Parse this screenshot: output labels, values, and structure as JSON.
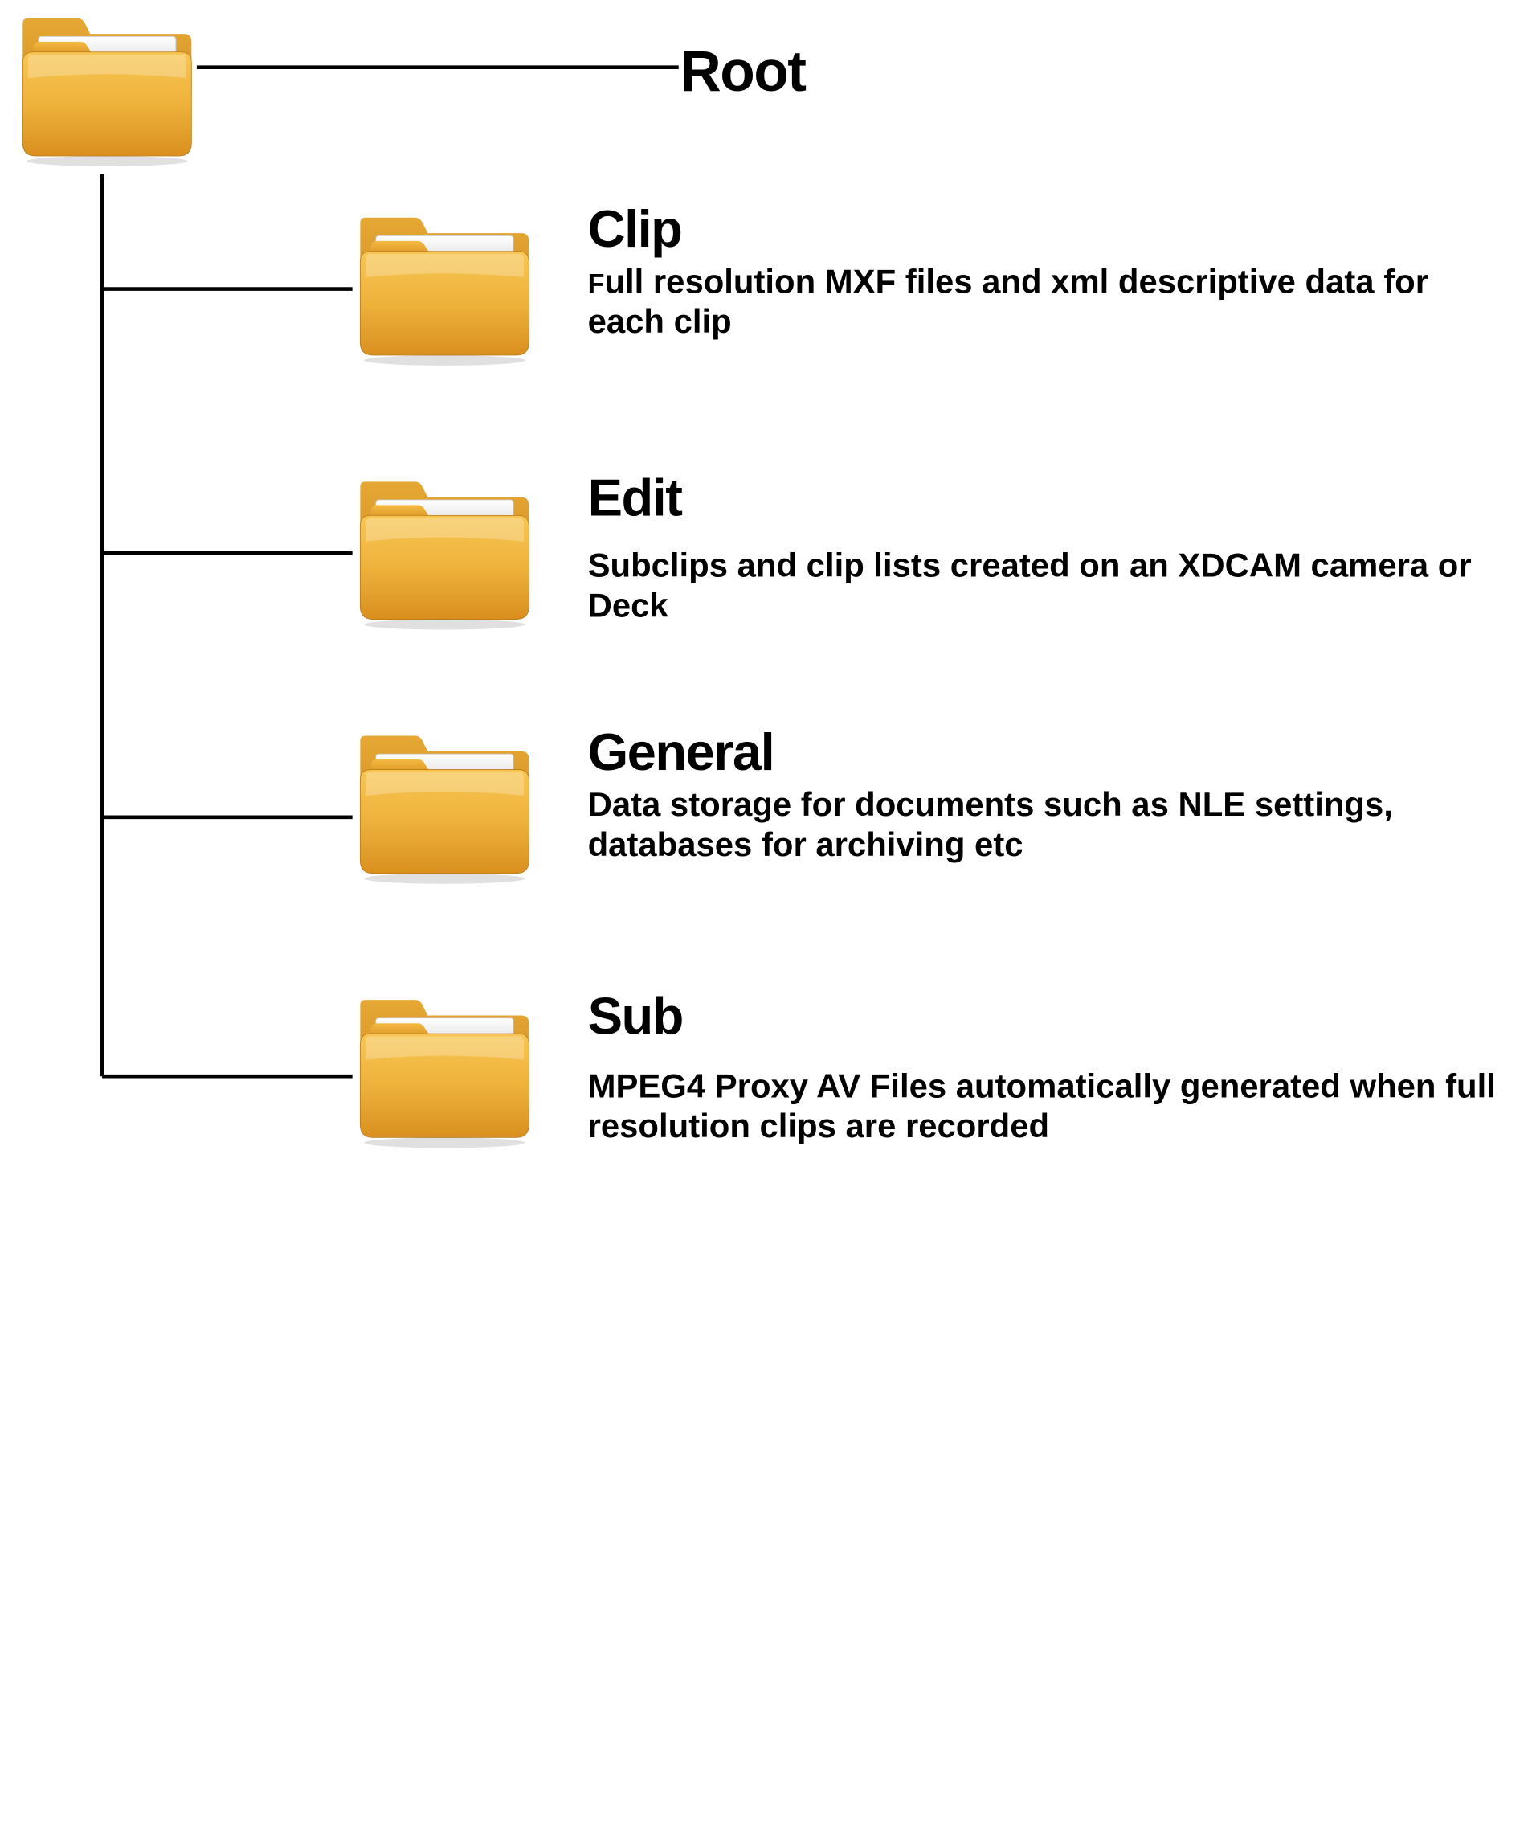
{
  "root": {
    "label": "Root"
  },
  "children": [
    {
      "title": "Clip",
      "desc_firstchar": "F",
      "desc_rest": "ull resolution MXF files and xml descriptive data for each clip"
    },
    {
      "title": "Edit",
      "desc_firstchar": "",
      "desc_rest": "Subclips and clip lists created on an XDCAM camera or Deck"
    },
    {
      "title": "General",
      "desc_firstchar": "",
      "desc_rest": "Data storage for documents such as NLE settings, databases for archiving etc"
    },
    {
      "title": "Sub",
      "desc_firstchar": "",
      "desc_rest": "MPEG4 Proxy AV Files automatically generated when full resolution clips are recorded"
    }
  ]
}
